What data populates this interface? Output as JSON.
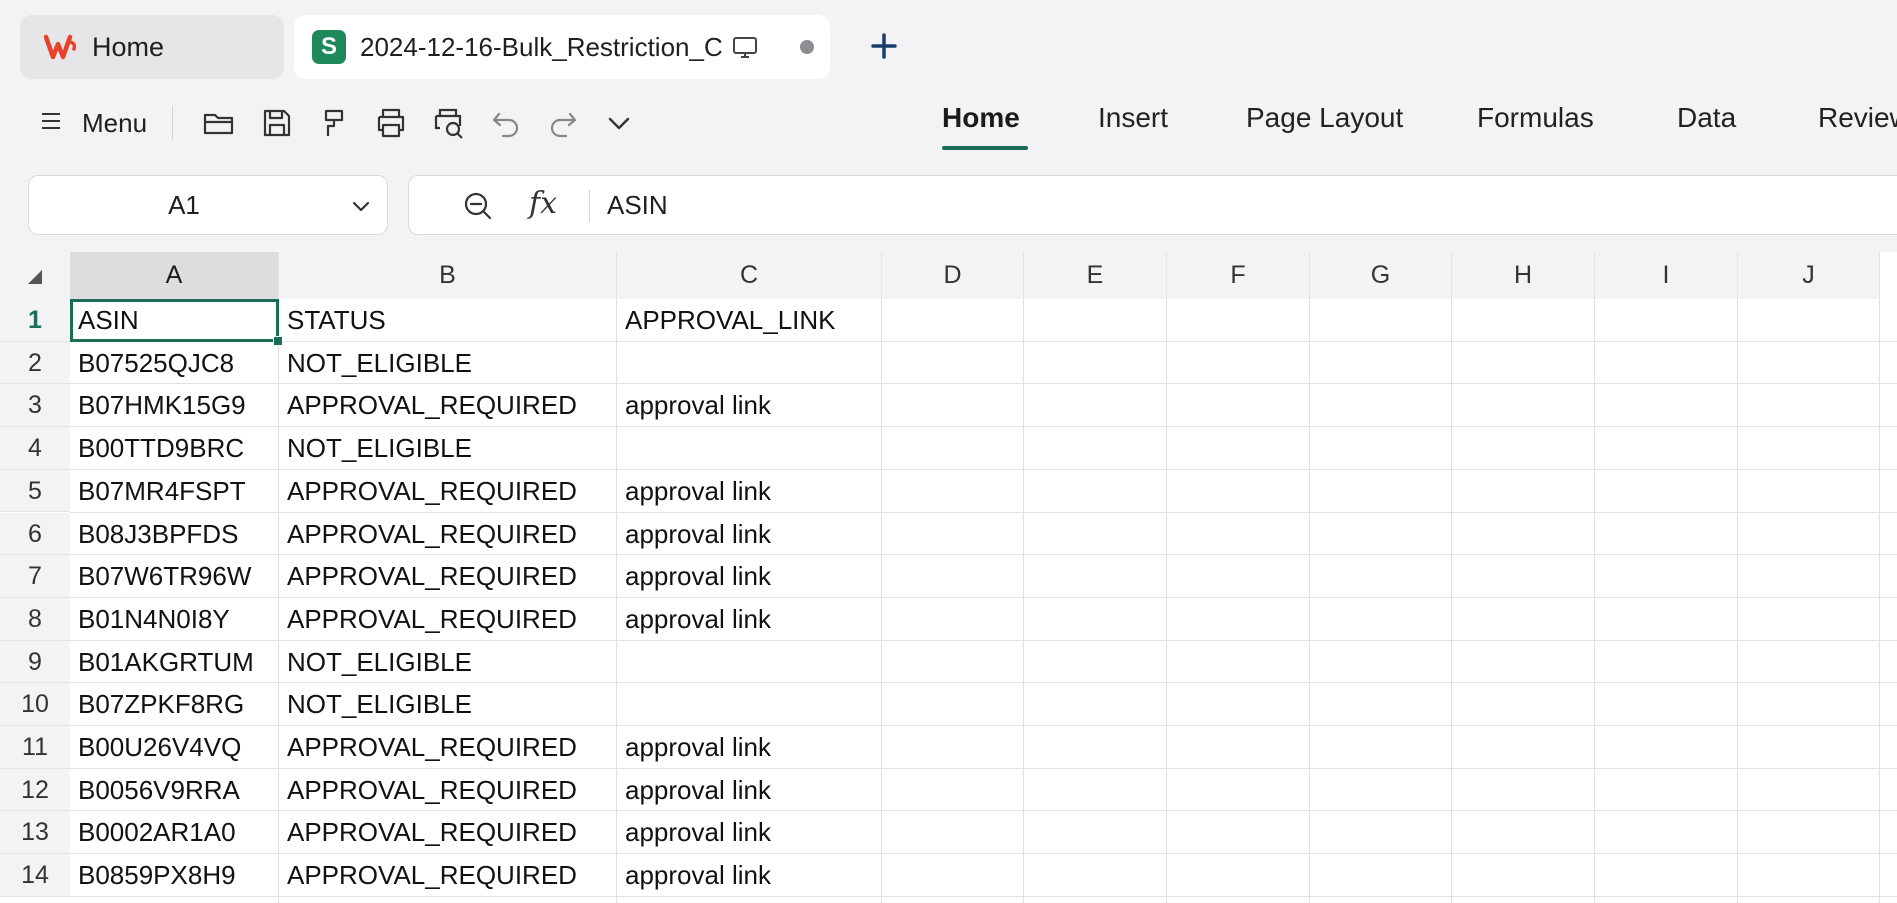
{
  "tabs": {
    "home_label": "Home",
    "doc_label": "2024-12-16-Bulk_Restriction_C",
    "doc_badge": "S"
  },
  "toolbar": {
    "menu_label": "Menu",
    "icons": [
      "open-folder-icon",
      "save-icon",
      "format-painter-icon",
      "print-icon",
      "print-preview-icon",
      "undo-icon",
      "redo-icon",
      "more-chevron-icon"
    ],
    "ribbon_tabs": [
      "Home",
      "Insert",
      "Page Layout",
      "Formulas",
      "Data",
      "Review"
    ],
    "active_tab": "Home"
  },
  "formula_bar": {
    "name_box": "A1",
    "fx_label": "fx",
    "formula_value": "ASIN"
  },
  "colors": {
    "accent": "#1a6e55",
    "badge": "#1e8a5c",
    "wps_logo": "#e8402a"
  },
  "sheet": {
    "columns": [
      "A",
      "B",
      "C",
      "D",
      "E",
      "F",
      "G",
      "H",
      "I",
      "J"
    ],
    "selected_column": "A",
    "selected_row": "1",
    "active_cell": "A1",
    "rows": [
      {
        "n": "1",
        "a": "ASIN",
        "b": "STATUS",
        "c": "APPROVAL_LINK"
      },
      {
        "n": "2",
        "a": "B07525QJC8",
        "b": "NOT_ELIGIBLE",
        "c": ""
      },
      {
        "n": "3",
        "a": "B07HMK15G9",
        "b": "APPROVAL_REQUIRED",
        "c": "approval link"
      },
      {
        "n": "4",
        "a": "B00TTD9BRC",
        "b": "NOT_ELIGIBLE",
        "c": ""
      },
      {
        "n": "5",
        "a": "B07MR4FSPT",
        "b": "APPROVAL_REQUIRED",
        "c": "approval link"
      },
      {
        "n": "6",
        "a": "B08J3BPFDS",
        "b": "APPROVAL_REQUIRED",
        "c": "approval link"
      },
      {
        "n": "7",
        "a": "B07W6TR96W",
        "b": "APPROVAL_REQUIRED",
        "c": "approval link"
      },
      {
        "n": "8",
        "a": "B01N4N0I8Y",
        "b": "APPROVAL_REQUIRED",
        "c": "approval link"
      },
      {
        "n": "9",
        "a": "B01AKGRTUM",
        "b": "NOT_ELIGIBLE",
        "c": ""
      },
      {
        "n": "10",
        "a": "B07ZPKF8RG",
        "b": "NOT_ELIGIBLE",
        "c": ""
      },
      {
        "n": "11",
        "a": "B00U26V4VQ",
        "b": "APPROVAL_REQUIRED",
        "c": "approval link"
      },
      {
        "n": "12",
        "a": "B0056V9RRA",
        "b": "APPROVAL_REQUIRED",
        "c": "approval link"
      },
      {
        "n": "13",
        "a": "B0002AR1A0",
        "b": "APPROVAL_REQUIRED",
        "c": "approval link"
      },
      {
        "n": "14",
        "a": "B0859PX8H9",
        "b": "APPROVAL_REQUIRED",
        "c": "approval link"
      }
    ]
  }
}
